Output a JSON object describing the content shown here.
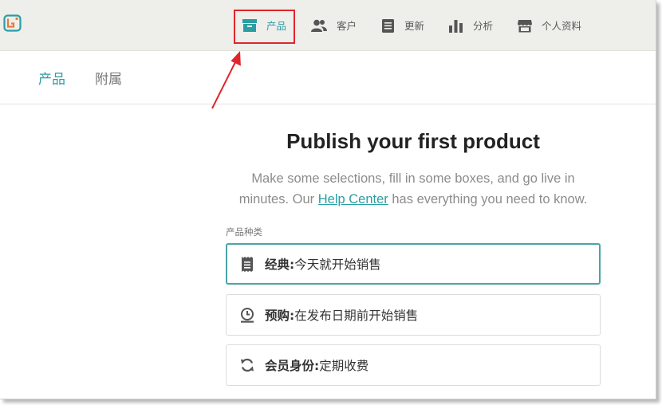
{
  "topnav": {
    "items": [
      {
        "label": "产品",
        "icon": "box-icon"
      },
      {
        "label": "客户",
        "icon": "users-icon"
      },
      {
        "label": "更新",
        "icon": "document-icon"
      },
      {
        "label": "分析",
        "icon": "bar-chart-icon"
      },
      {
        "label": "个人资料",
        "icon": "storefront-icon"
      }
    ],
    "active_index": 0
  },
  "subnav": {
    "tabs": [
      "产品",
      "附属"
    ],
    "active_index": 0
  },
  "main": {
    "title": "Publish your first product",
    "intro_before": "Make some selections, fill in some boxes, and go live in minutes. Our ",
    "help_link": "Help Center",
    "intro_after": " has everything you need to know.",
    "product_type_label": "产品种类",
    "options": [
      {
        "name": "经典:",
        "desc": " 今天就开始销售",
        "icon": "receipt-icon",
        "selected": true
      },
      {
        "name": "预购:",
        "desc": " 在发布日期前开始销售",
        "icon": "clock-icon",
        "selected": false
      },
      {
        "name": "会员身份:",
        "desc": " 定期收费",
        "icon": "refresh-icon",
        "selected": false
      }
    ]
  },
  "colors": {
    "accent": "#2a9ea3",
    "annotation": "#e0252c",
    "topbar": "#eeeeea"
  }
}
